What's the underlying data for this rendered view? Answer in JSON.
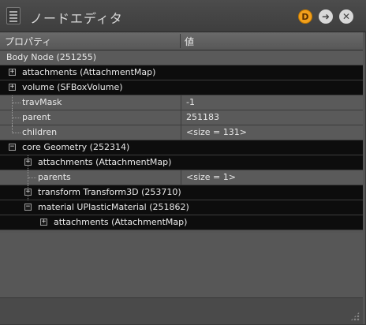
{
  "window": {
    "title": "ノードエディタ",
    "icon": "document-icon",
    "buttons": [
      {
        "name": "d-button",
        "label": "D",
        "color": "#f2a01c"
      },
      {
        "name": "forward-button",
        "icon": "arrow-right-icon",
        "glyph": "➜"
      },
      {
        "name": "close-button",
        "icon": "close-icon",
        "glyph": "✕"
      }
    ]
  },
  "columns": {
    "property": "プロパティ",
    "value": "値"
  },
  "tree": {
    "root": "Body Node (251255)",
    "rows": [
      {
        "label": "attachments (AttachmentMap)",
        "value": "",
        "expander": "+"
      },
      {
        "label": "volume (SFBoxVolume)",
        "value": "",
        "expander": "+"
      },
      {
        "label": "travMask",
        "value": "-1",
        "expander": ""
      },
      {
        "label": "parent",
        "value": "251183",
        "expander": ""
      },
      {
        "label": "children",
        "value": "<size = 131>",
        "expander": ""
      },
      {
        "label": "core Geometry (252314)",
        "value": "",
        "expander": "−"
      },
      {
        "label": "attachments (AttachmentMap)",
        "value": "",
        "expander": "+"
      },
      {
        "label": "parents",
        "value": "<size = 1>",
        "expander": ""
      },
      {
        "label": "transform Transform3D (253710)",
        "value": "",
        "expander": "+"
      },
      {
        "label": "material UPlasticMaterial (251862)",
        "value": "",
        "expander": "−"
      },
      {
        "label": "attachments (AttachmentMap)",
        "value": "",
        "expander": "+"
      }
    ]
  },
  "colors": {
    "accent": "#f2a01c",
    "row_dark": "#0d0d0d",
    "row_light": "#5a5a5a"
  }
}
